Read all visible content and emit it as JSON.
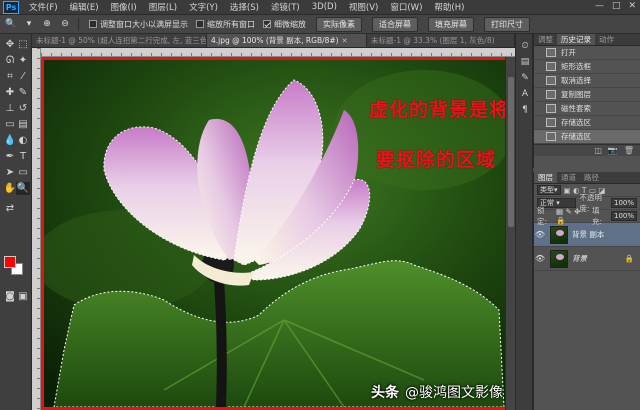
{
  "menu": {
    "logo": "Ps",
    "items": [
      "文件(F)",
      "编辑(E)",
      "图像(I)",
      "图层(L)",
      "文字(Y)",
      "选择(S)",
      "滤镜(T)",
      "3D(D)",
      "视图(V)",
      "窗口(W)",
      "帮助(H)"
    ],
    "window_controls": [
      "—",
      "□",
      "✕"
    ]
  },
  "options": {
    "check_resize": "调整窗口大小以满屏显示",
    "check_all": "缩放所有窗口",
    "check_scrubby": "细微缩放",
    "btn_actual": "实际像素",
    "btn_fit": "适合屏幕",
    "btn_fill": "填充屏幕",
    "btn_print": "打印尺寸"
  },
  "doc_tabs": [
    {
      "title": "未标题-1 @ 50% (超人连招第二行完成, 左, 蓝三色通道)",
      "active": false
    },
    {
      "title": "4.jpg @ 100% (背景 副本, RGB/8#)",
      "active": true
    },
    {
      "title": "未标题-1 @ 33.3% (图层 1, 灰色/8)",
      "active": false
    }
  ],
  "canvas": {
    "annotation_line1": "虚化的背景是将",
    "annotation_line2": "要抠除的区域",
    "border_color": "#e01616"
  },
  "watermark": {
    "brand": "头条",
    "author": "@骏鸿图文影像"
  },
  "history_panel": {
    "tabs": [
      "调整",
      "历史记录",
      "动作"
    ],
    "items": [
      "打开",
      "矩形选框",
      "取消选择",
      "复制图层",
      "磁性套索",
      "存储选区",
      "存储选区"
    ],
    "selected_index": 6
  },
  "layers_panel": {
    "tabs": [
      "图层",
      "通道",
      "路径"
    ],
    "kind_label": "类型",
    "blend_mode": "正常",
    "opacity_label": "不透明度:",
    "opacity_value": "100%",
    "lock_label": "锁定:",
    "fill_label": "填充:",
    "fill_value": "100%",
    "layers": [
      {
        "name": "背景 副本",
        "selected": true
      },
      {
        "name": "背景",
        "selected": false
      }
    ]
  }
}
